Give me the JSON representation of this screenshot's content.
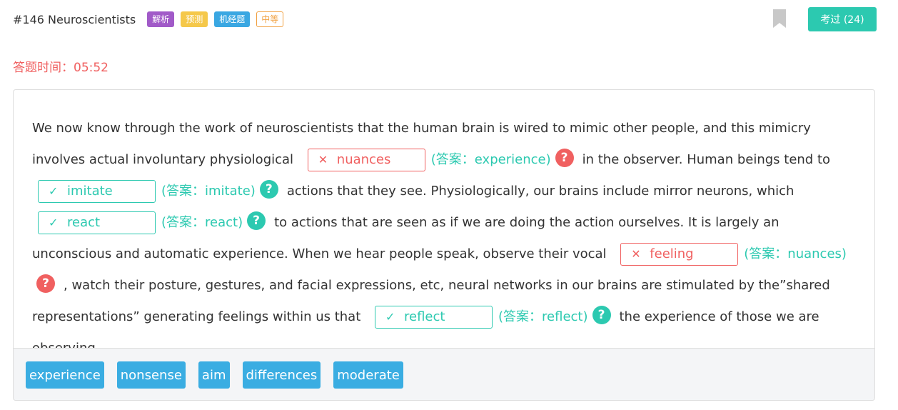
{
  "header": {
    "title": "#146 Neuroscientists",
    "tags": [
      "解析",
      "预测",
      "机经题",
      "中等"
    ],
    "exam_button": "考过 (24)"
  },
  "timer": "答题时间：05:52",
  "colors": {
    "correct": "#2cc9b0",
    "wrong": "#f06060",
    "word_bank": "#3aade2",
    "accent": "#2cc9b0"
  },
  "passage": {
    "seg0": "We now know through the work of neuroscientists that the human brain is wired to mimic other people, and this mimicry involves actual involuntary physiological",
    "seg1": "in the observer. Human beings tend to",
    "seg2": "actions that they see. Physiologically, our brains include mirror neurons, which",
    "seg3": "to actions that are seen as if we are doing the action ourselves. It is largely an unconscious and automatic experience. When we hear people speak, observe their vocal",
    "seg4": ", watch their posture, gestures, and facial expressions, etc, neural networks in our brains are stimulated by the”shared representations” generating feelings within us that",
    "seg5": "the experience of those we are observing."
  },
  "blanks": [
    {
      "mark": "✕",
      "value": "nuances",
      "answer": "(答案：experience)",
      "status": "wrong"
    },
    {
      "mark": "✓",
      "value": "imitate",
      "answer": "(答案：imitate)",
      "status": "correct"
    },
    {
      "mark": "✓",
      "value": "react",
      "answer": "(答案：react)",
      "status": "correct"
    },
    {
      "mark": "✕",
      "value": "feeling",
      "answer": "(答案：nuances)",
      "status": "wrong"
    },
    {
      "mark": "✓",
      "value": "reflect",
      "answer": "(答案：reflect)",
      "status": "correct"
    }
  ],
  "help_icon_glyph": "?",
  "word_bank": [
    "experience",
    "nonsense",
    "aim",
    "differences",
    "moderate"
  ]
}
